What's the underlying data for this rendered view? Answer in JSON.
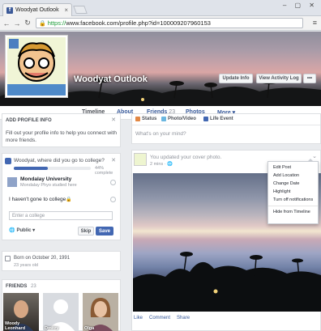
{
  "browser": {
    "tab_title": "Woodyat Outlook",
    "tab_close": "×",
    "url_protocol": "https://",
    "url_rest": "www.facebook.com/profile.php?id=100009207960153",
    "window_controls": "– ▢ ✕"
  },
  "cover": {
    "name": "Woodyat Outlook",
    "update_info_label": "Update Info",
    "view_activity_label": "View Activity Log",
    "more_label": "•••"
  },
  "profile_nav": {
    "timeline": "Timeline",
    "about": "About",
    "friends": "Friends",
    "friends_count": "23",
    "photos": "Photos",
    "more": "More ▾"
  },
  "profile_info": {
    "heading": "ADD PROFILE INFO",
    "body": "Fill out your profile info to help you connect with more friends."
  },
  "college": {
    "question": "Woodyat, where did you go to college?",
    "progress_text": "44% complete",
    "progress_percent": 44,
    "option1_name": "Mondalay University",
    "option1_sub": "Mondalay Phyo studied here",
    "option2_label": "I haven't gone to college",
    "placeholder": "Enter a college",
    "privacy": "Public ▾",
    "skip": "Skip",
    "save": "Save"
  },
  "born": {
    "text": "Born on October 20, 1991",
    "age": "23 years old"
  },
  "friends": {
    "heading": "FRIENDS",
    "count": "23",
    "list": [
      {
        "name": "Woody Leonhard"
      },
      {
        "name": "Dmitry"
      },
      {
        "name": "Olga"
      }
    ]
  },
  "composer": {
    "status": "Status",
    "photo_video": "Photo/Video",
    "life_event": "Life Event",
    "placeholder": "What's on your mind?"
  },
  "post": {
    "header": "You updated your cover photo.",
    "time": "2 mins · ",
    "like": "Like",
    "comment": "Comment",
    "share": "Share"
  },
  "post_menu": {
    "items": [
      "Edit Post",
      "Add Location",
      "Change Date",
      "Highlight",
      "Turn off notifications"
    ],
    "hide": "Hide from Timeline"
  },
  "colors": {
    "brand": "#3b5998",
    "button_blue": "#4267b2",
    "link": "#365899"
  }
}
